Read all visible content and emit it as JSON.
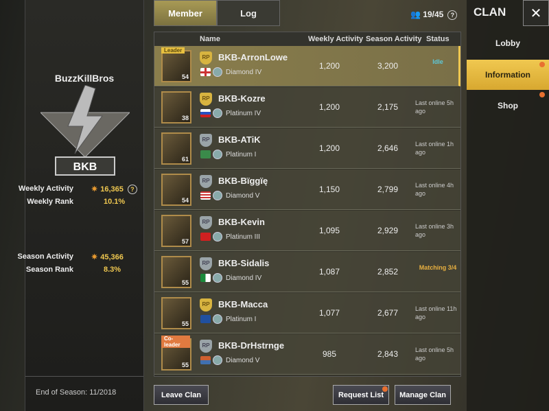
{
  "clan": {
    "name": "BuzzKillBros",
    "tag": "BKB",
    "weekly_activity_label": "Weekly Activity",
    "weekly_activity": "16,365",
    "weekly_rank_label": "Weekly Rank",
    "weekly_rank": "10.1%",
    "season_activity_label": "Season Activity",
    "season_activity": "45,366",
    "season_rank_label": "Season Rank",
    "season_rank": "8.3%",
    "end_of_season": "End of Season:  11/2018"
  },
  "tabs": [
    {
      "label": "Member",
      "active": true
    },
    {
      "label": "Log",
      "active": false
    }
  ],
  "member_count": "19/45",
  "columns": {
    "name": "Name",
    "weekly": "Weekly Activity",
    "season": "Season Activity",
    "status": "Status"
  },
  "members": [
    {
      "name": "BKB-ArronLowe",
      "level": "54",
      "badge": "Leader",
      "rp": "gold",
      "tier": "Diamond IV",
      "weekly": "1,200",
      "season": "3,200",
      "status": "Idle",
      "status_color": "#5ec8d8",
      "flag": "uk"
    },
    {
      "name": "BKB-Kozre",
      "level": "38",
      "badge": "",
      "rp": "gold",
      "tier": "Platinum IV",
      "weekly": "1,200",
      "season": "2,175",
      "status": "Last online 5h ago",
      "flag": "ru"
    },
    {
      "name": "BKB-ATiK",
      "level": "61",
      "badge": "",
      "rp": "silver",
      "tier": "Platinum I",
      "weekly": "1,200",
      "season": "2,646",
      "status": "Last online 1h ago",
      "flag": "other"
    },
    {
      "name": "BKB-Bïggïę",
      "level": "54",
      "badge": "",
      "rp": "silver",
      "tier": "Diamond V",
      "weekly": "1,150",
      "season": "2,799",
      "status": "Last online 4h ago",
      "flag": "us"
    },
    {
      "name": "BKB-Kevin",
      "level": "57",
      "badge": "",
      "rp": "silver",
      "tier": "Platinum III",
      "weekly": "1,095",
      "season": "2,929",
      "status": "Last online 3h ago",
      "flag": "al"
    },
    {
      "name": "BKB-Sidalis",
      "level": "55",
      "badge": "",
      "rp": "silver",
      "tier": "Diamond IV",
      "weekly": "1,087",
      "season": "2,852",
      "status": "Matching 3/4",
      "status_color": "#e8b040",
      "flag": "dz"
    },
    {
      "name": "BKB-Macca",
      "level": "55",
      "badge": "",
      "rp": "gold",
      "tier": "Platinum I",
      "weekly": "1,077",
      "season": "2,677",
      "status": "Last online 11h ago",
      "flag": "au"
    },
    {
      "name": "BKB-DrHstrnge",
      "level": "55",
      "badge": "Co-leader",
      "rp": "silver",
      "tier": "Diamond V",
      "weekly": "985",
      "season": "2,843",
      "status": "Last online 5h ago",
      "flag": "other2"
    }
  ],
  "sidebar": {
    "title": "CLAN",
    "close": "✕",
    "items": [
      {
        "label": "Lobby"
      },
      {
        "label": "Information",
        "active": true
      },
      {
        "label": "Shop"
      }
    ]
  },
  "buttons": {
    "leave": "Leave Clan",
    "request": "Request List",
    "manage": "Manage Clan"
  },
  "rp_label": "RP"
}
